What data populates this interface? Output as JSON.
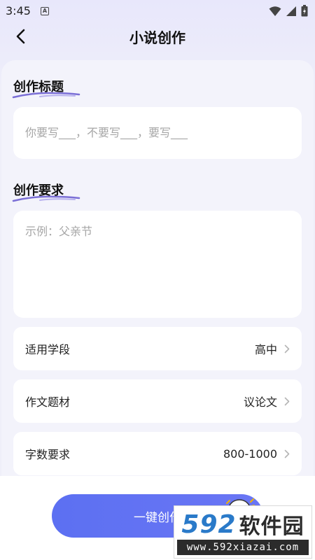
{
  "status_bar": {
    "time": "3:45",
    "notif_letter": "A"
  },
  "header": {
    "title": "小说创作"
  },
  "title_section": {
    "label": "创作标题",
    "placeholder": "你要写___，不要写___，要写___"
  },
  "requirement_section": {
    "label": "创作要求",
    "placeholder": "示例：父亲节"
  },
  "options": [
    {
      "label": "适用学段",
      "value": "高中"
    },
    {
      "label": "作文题材",
      "value": "议论文"
    },
    {
      "label": "字数要求",
      "value": "800-1000"
    }
  ],
  "create_button": {
    "label": "一键创作"
  },
  "watermark": {
    "number": "592",
    "name": "软件园",
    "url": "www.592xiazai.com"
  },
  "colors": {
    "accent": "#5c70f2",
    "underline": "#7b6fd6"
  }
}
